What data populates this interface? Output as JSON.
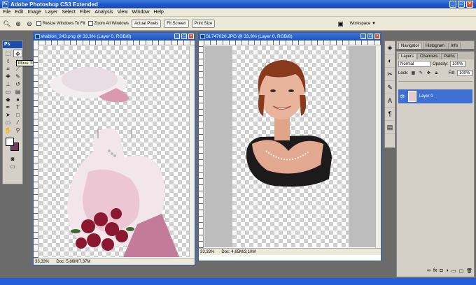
{
  "window": {
    "title": "Adobe Photoshop CS3 Extended",
    "app_icon": "Ps"
  },
  "menu": [
    "File",
    "Edit",
    "Image",
    "Layer",
    "Select",
    "Filter",
    "Analysis",
    "View",
    "Window",
    "Help"
  ],
  "options": {
    "resize_windows": "Resize Windows To Fit",
    "zoom_all": "Zoom All Windows",
    "actual_pixels": "Actual Pixels",
    "fit_screen": "Fit Screen",
    "print_size": "Print Size",
    "workspace": "Workspace ▼"
  },
  "toolbox": {
    "label": "Ps",
    "tooltip": "Move Tool (V)"
  },
  "docs": [
    {
      "title": "shablon_243.png @ 33,3% (Layer 0, RGB/8)",
      "zoom": "33,33%",
      "size": "Doc: 5,86M/7,37M"
    },
    {
      "title": "SL747020.JPG @ 33,3% (Layer 0, RGB/8)",
      "zoom": "33,33%",
      "size": "Doc: 4,65M/3,10M"
    }
  ],
  "panels": {
    "top_tabs": [
      "Navigator",
      "Histogram",
      "Info"
    ],
    "layer_tabs": [
      "Layers",
      "Channels",
      "Paths"
    ],
    "blend_mode": "Normal",
    "opacity_label": "Opacity:",
    "opacity_value": "100%",
    "lock_label": "Lock:",
    "fill_label": "Fill:",
    "fill_value": "100%",
    "layer_name": "Layer 0"
  }
}
